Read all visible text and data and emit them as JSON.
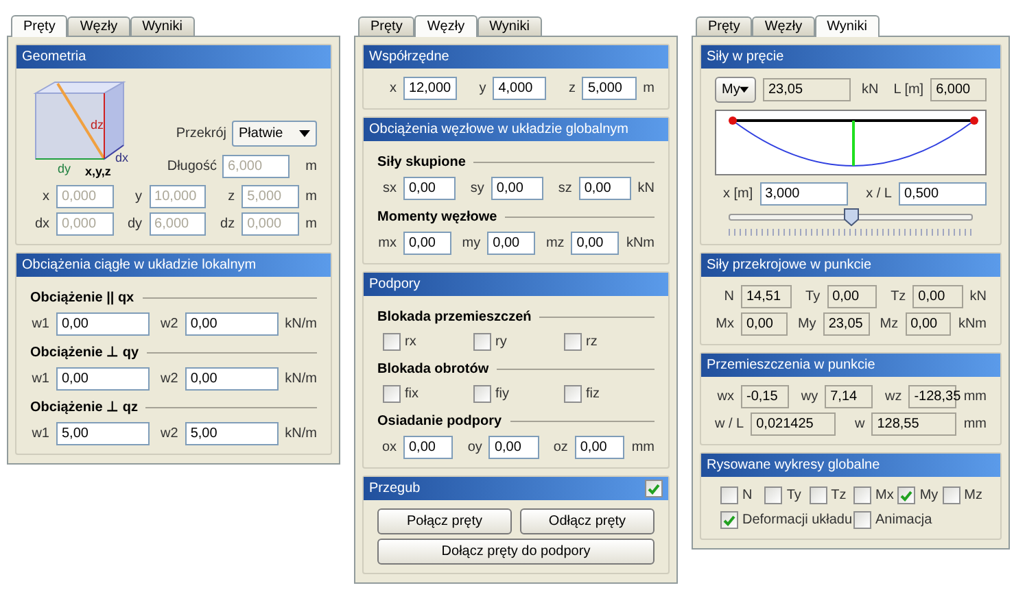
{
  "panels": [
    {
      "tabs": [
        {
          "label": "Pręty",
          "selected": true
        },
        {
          "label": "Węzły",
          "selected": false
        },
        {
          "label": "Wyniki",
          "selected": false
        }
      ],
      "sections": [
        {
          "title": "Geometria",
          "rows": [
            {
              "kind": "geometry",
              "labels": [
                "dz",
                "dx",
                "dy",
                "x,y,z"
              ],
              "section_label": "Przekrój",
              "section_value": "Płatwie",
              "length_label": "Długość",
              "length_value": "6,000",
              "length_unit": "m",
              "disabled": true
            },
            {
              "kind": "fields",
              "disabled": true,
              "readonly": false,
              "items": [
                {
                  "label": "x",
                  "value": "0,000"
                },
                {
                  "label": "y",
                  "value": "10,000"
                },
                {
                  "label": "z",
                  "value": "5,000"
                }
              ],
              "unit": "m"
            },
            {
              "kind": "fields",
              "disabled": true,
              "readonly": false,
              "items": [
                {
                  "label": "dx",
                  "value": "0,000"
                },
                {
                  "label": "dy",
                  "value": "6,000"
                },
                {
                  "label": "dz",
                  "value": "0,000"
                }
              ],
              "unit": "m"
            }
          ]
        },
        {
          "title": "Obciążenia ciągłe w układzie lokalnym",
          "rows": [
            {
              "kind": "heading",
              "text": "Obciążenie || qx"
            },
            {
              "kind": "fields",
              "disabled": false,
              "readonly": false,
              "items": [
                {
                  "label": "w1",
                  "value": "0,00"
                },
                {
                  "label": "w2",
                  "value": "0,00"
                }
              ],
              "unit": "kN/m"
            },
            {
              "kind": "heading",
              "text": "Obciążenie ⊥ qy"
            },
            {
              "kind": "fields",
              "disabled": false,
              "readonly": false,
              "items": [
                {
                  "label": "w1",
                  "value": "0,00"
                },
                {
                  "label": "w2",
                  "value": "0,00"
                }
              ],
              "unit": "kN/m"
            },
            {
              "kind": "heading",
              "text": "Obciążenie ⊥ qz"
            },
            {
              "kind": "fields",
              "disabled": false,
              "readonly": false,
              "items": [
                {
                  "label": "w1",
                  "value": "5,00"
                },
                {
                  "label": "w2",
                  "value": "5,00"
                }
              ],
              "unit": "kN/m"
            }
          ]
        }
      ]
    },
    {
      "tabs": [
        {
          "label": "Pręty",
          "selected": false
        },
        {
          "label": "Węzły",
          "selected": true
        },
        {
          "label": "Wyniki",
          "selected": false
        }
      ],
      "sections": [
        {
          "title": "Współrzędne",
          "rows": [
            {
              "kind": "fields",
              "disabled": false,
              "readonly": false,
              "items": [
                {
                  "label": "x",
                  "value": "12,000"
                },
                {
                  "label": "y",
                  "value": "4,000"
                },
                {
                  "label": "z",
                  "value": "5,000"
                }
              ],
              "unit": "m"
            }
          ]
        },
        {
          "title": "Obciążenia węzłowe w układzie globalnym",
          "rows": [
            {
              "kind": "heading",
              "text": "Siły skupione"
            },
            {
              "kind": "fields",
              "disabled": false,
              "readonly": false,
              "items": [
                {
                  "label": "sx",
                  "value": "0,00"
                },
                {
                  "label": "sy",
                  "value": "0,00"
                },
                {
                  "label": "sz",
                  "value": "0,00"
                }
              ],
              "unit": "kN"
            },
            {
              "kind": "heading",
              "text": "Momenty węzłowe"
            },
            {
              "kind": "fields",
              "disabled": false,
              "readonly": false,
              "items": [
                {
                  "label": "mx",
                  "value": "0,00"
                },
                {
                  "label": "my",
                  "value": "0,00"
                },
                {
                  "label": "mz",
                  "value": "0,00"
                }
              ],
              "unit": "kNm"
            }
          ]
        },
        {
          "title": "Podpory",
          "rows": [
            {
              "kind": "heading",
              "text": "Blokada przemieszczeń"
            },
            {
              "kind": "checks",
              "items": [
                {
                  "label": "rx",
                  "checked": false
                },
                {
                  "label": "ry",
                  "checked": false
                },
                {
                  "label": "rz",
                  "checked": false
                }
              ]
            },
            {
              "kind": "heading",
              "text": "Blokada obrotów"
            },
            {
              "kind": "checks",
              "items": [
                {
                  "label": "fix",
                  "checked": false
                },
                {
                  "label": "fiy",
                  "checked": false
                },
                {
                  "label": "fiz",
                  "checked": false
                }
              ]
            },
            {
              "kind": "heading",
              "text": "Osiadanie podpory"
            },
            {
              "kind": "fields",
              "disabled": false,
              "readonly": false,
              "items": [
                {
                  "label": "ox",
                  "value": "0,00"
                },
                {
                  "label": "oy",
                  "value": "0,00"
                },
                {
                  "label": "oz",
                  "value": "0,00"
                }
              ],
              "unit": "mm"
            }
          ]
        },
        {
          "title": "Przegub",
          "checked": true,
          "rows": [
            {
              "kind": "buttons",
              "items": [
                "Połącz pręty",
                "Odłącz pręty"
              ]
            },
            {
              "kind": "buttons",
              "items": [
                "Dołącz pręty do podpory"
              ]
            }
          ]
        }
      ]
    },
    {
      "tabs": [
        {
          "label": "Pręty",
          "selected": false
        },
        {
          "label": "Węzły",
          "selected": false
        },
        {
          "label": "Wyniki",
          "selected": true
        }
      ],
      "sections": [
        {
          "title": "Siły w pręcie",
          "rows": [
            {
              "kind": "force_chart",
              "component": "My",
              "value": "23,05",
              "unit": "kN",
              "length_label": "L [m]",
              "length_value": "6,000",
              "x_label": "x [m]",
              "x_value": "3,000",
              "ratio_label": "x / L",
              "ratio_value": "0,500",
              "level": 0.5
            }
          ]
        },
        {
          "title": "Siły przekrojowe w punkcie",
          "rows": [
            {
              "kind": "fields",
              "disabled": false,
              "readonly": true,
              "items": [
                {
                  "label": "N",
                  "value": "14,51"
                },
                {
                  "label": "Ty",
                  "value": "0,00"
                },
                {
                  "label": "Tz",
                  "value": "0,00"
                }
              ],
              "unit": "kN"
            },
            {
              "kind": "fields",
              "disabled": false,
              "readonly": true,
              "items": [
                {
                  "label": "Mx",
                  "value": "0,00"
                },
                {
                  "label": "My",
                  "value": "23,05"
                },
                {
                  "label": "Mz",
                  "value": "0,00"
                }
              ],
              "unit": "kNm"
            }
          ]
        },
        {
          "title": "Przemieszczenia w punkcie",
          "rows": [
            {
              "kind": "fields",
              "disabled": false,
              "readonly": true,
              "items": [
                {
                  "label": "wx",
                  "value": "-0,15"
                },
                {
                  "label": "wy",
                  "value": "7,14"
                },
                {
                  "label": "wz",
                  "value": "-128,35"
                }
              ],
              "unit": "mm"
            },
            {
              "kind": "fields",
              "disabled": false,
              "readonly": true,
              "items": [
                {
                  "label": "w / L",
                  "value": "0,021425"
                },
                {
                  "label": "w",
                  "value": "128,55"
                }
              ],
              "unit": "mm"
            }
          ]
        },
        {
          "title": "Rysowane wykresy globalne",
          "rows": [
            {
              "kind": "checks",
              "items": [
                {
                  "label": "N",
                  "checked": false
                },
                {
                  "label": "Ty",
                  "checked": false
                },
                {
                  "label": "Tz",
                  "checked": false
                },
                {
                  "label": "Mx",
                  "checked": false
                },
                {
                  "label": "My",
                  "checked": true
                },
                {
                  "label": "Mz",
                  "checked": false
                }
              ]
            },
            {
              "kind": "checks",
              "items": [
                {
                  "label": "Deformacji układu",
                  "checked": true
                },
                {
                  "label": "Animacja",
                  "checked": false
                }
              ]
            }
          ]
        }
      ]
    }
  ]
}
